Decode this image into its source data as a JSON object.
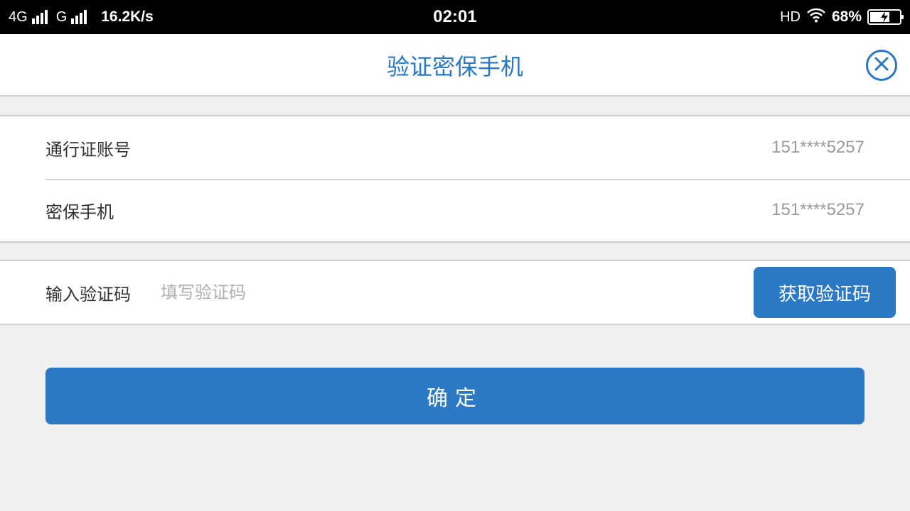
{
  "status_bar": {
    "net1": "4G",
    "net2": "G",
    "speed": "16.2K/s",
    "time": "02:01",
    "hd": "HD",
    "battery_pct": "68%",
    "battery_level": 0.68
  },
  "header": {
    "title": "验证密保手机",
    "close_icon": "close-circle-icon"
  },
  "info": {
    "rows": [
      {
        "label": "通行证账号",
        "value": "151****5257"
      },
      {
        "label": "密保手机",
        "value": "151****5257"
      }
    ]
  },
  "verify": {
    "label": "输入验证码",
    "input_value": "",
    "placeholder": "填写验证码",
    "get_code_label": "获取验证码"
  },
  "confirm_label": "确定",
  "colors": {
    "accent": "#2b78c5",
    "background": "#f0f0f0"
  }
}
